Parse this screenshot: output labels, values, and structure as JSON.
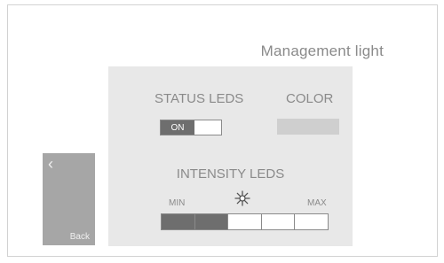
{
  "header": {
    "title": "Management light"
  },
  "back": {
    "chevron": "‹",
    "label": "Back"
  },
  "status_leds": {
    "label": "STATUS LEDS",
    "toggle_value": "ON"
  },
  "color": {
    "label": "COLOR",
    "swatch_color": "#cfcfcf"
  },
  "intensity": {
    "label": "INTENSITY LEDS",
    "min_label": "MIN",
    "max_label": "MAX",
    "icon": "sun-icon",
    "level": 2,
    "segments": 5
  },
  "colors": {
    "accent": "#6e6e6e",
    "panel": "#e8e8e8",
    "back_button": "#a6a6a6",
    "text": "#8a8a8a"
  }
}
